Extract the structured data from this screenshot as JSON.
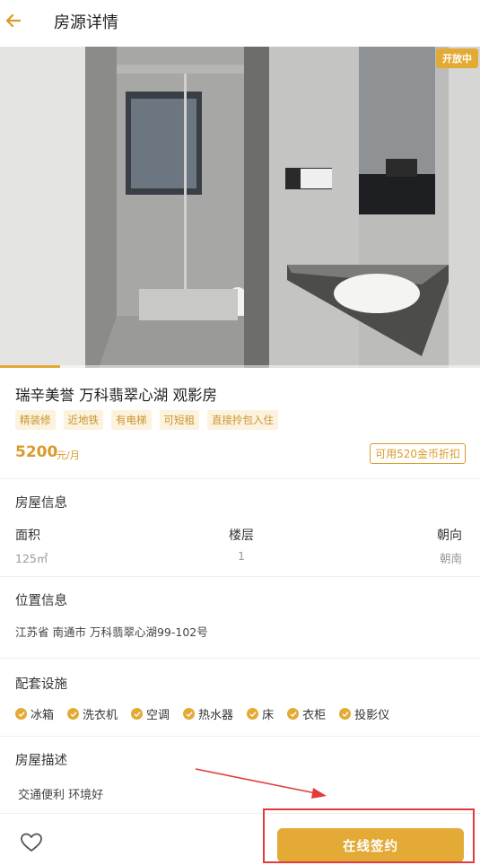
{
  "header": {
    "title": "房源详情",
    "back_icon": "arrow-left-icon",
    "accent_color": "#e3aa36"
  },
  "photo": {
    "status_badge": "开放中",
    "carousel_progress": 0.125
  },
  "listing": {
    "title": "瑞辛美誉 万科翡翠心湖 观影房",
    "tags": [
      "精装修",
      "近地铁",
      "有电梯",
      "可短租",
      "直接拎包入住"
    ],
    "price": "5200",
    "price_unit": "元/月",
    "coupon": "可用520金币折扣"
  },
  "house_info": {
    "section_title": "房屋信息",
    "area_label": "面积",
    "area_value": "125㎡",
    "floor_label": "楼层",
    "floor_value": "1",
    "orientation_label": "朝向",
    "orientation_value": "朝南"
  },
  "location": {
    "section_title": "位置信息",
    "address": "江苏省 南通市 万科翡翠心湖99-102号"
  },
  "facilities": {
    "section_title": "配套设施",
    "items": [
      "冰箱",
      "洗衣机",
      "空调",
      "热水器",
      "床",
      "衣柜",
      "投影仪"
    ]
  },
  "description": {
    "section_title": "房屋描述",
    "text": "交通便利 环境好"
  },
  "bottom_bar": {
    "favorite_icon": "heart-icon",
    "sign_button": "在线签约"
  },
  "annotation": {
    "color": "#e23b3b"
  }
}
